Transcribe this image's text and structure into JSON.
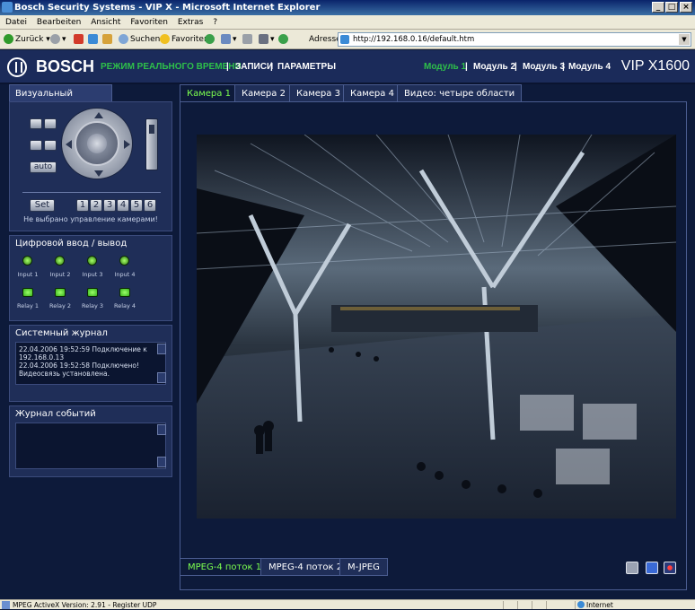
{
  "browser": {
    "title": "Bosch Security Systems - VIP X - Microsoft Internet Explorer",
    "menu": [
      "Datei",
      "Bearbeiten",
      "Ansicht",
      "Favoriten",
      "Extras",
      "?"
    ],
    "toolbar": {
      "back": "Zurück",
      "search": "Suchen",
      "favorites": "Favoriten",
      "address_label": "Adresse"
    },
    "address": "http://192.168.0.16/default.htm",
    "status": "MPEG ActiveX Version: 2.91 - Register UDP",
    "zone": "Internet"
  },
  "header": {
    "brand": "BOSCH",
    "nav": {
      "live": "РЕЖИМ РЕАЛЬНОГО ВРЕМЕНИ",
      "sep1": " | ",
      "records": "ЗАПИСИ",
      "sep2": " | ",
      "params": "ПАРАМЕТРЫ"
    },
    "modules": [
      "Модуль 1",
      "Модуль 2",
      "Модуль 3",
      "Модуль 4"
    ],
    "module_sep": " | ",
    "product": "VIP X1600"
  },
  "ptz": {
    "tab": "Визуальный контроль",
    "auto": "auto",
    "set": "Set",
    "presets": [
      "1",
      "2",
      "3",
      "4",
      "5",
      "6"
    ],
    "message": "Не выбрано управление камерами!"
  },
  "io": {
    "title": "Цифровой ввод / вывод",
    "inputs": [
      "Input 1",
      "Input 2",
      "Input 3",
      "Input 4"
    ],
    "relays": [
      "Relay 1",
      "Relay 2",
      "Relay 3",
      "Relay 4"
    ]
  },
  "syslog": {
    "title": "Системный журнал",
    "lines": [
      "22.04.2006 19:52:59 Подключение к",
      "192.168.0.13",
      "22.04.2006 19:52:58 Подключено!",
      "Видеосвязь установлена."
    ]
  },
  "eventlog": {
    "title": "Журнал событий"
  },
  "cameras": {
    "tabs": [
      "Камера 1",
      "Камера 2",
      "Камера 3",
      "Камера 4",
      "Видео: четыре области"
    ],
    "active": 0
  },
  "streams": {
    "tabs": [
      "MPEG-4 поток 1",
      "MPEG-4 поток 2",
      "M-JPEG"
    ],
    "active": 0
  },
  "colors": {
    "accent_green": "#7cff4f",
    "panel": "#1f2e58",
    "background": "#0d1a3a"
  }
}
